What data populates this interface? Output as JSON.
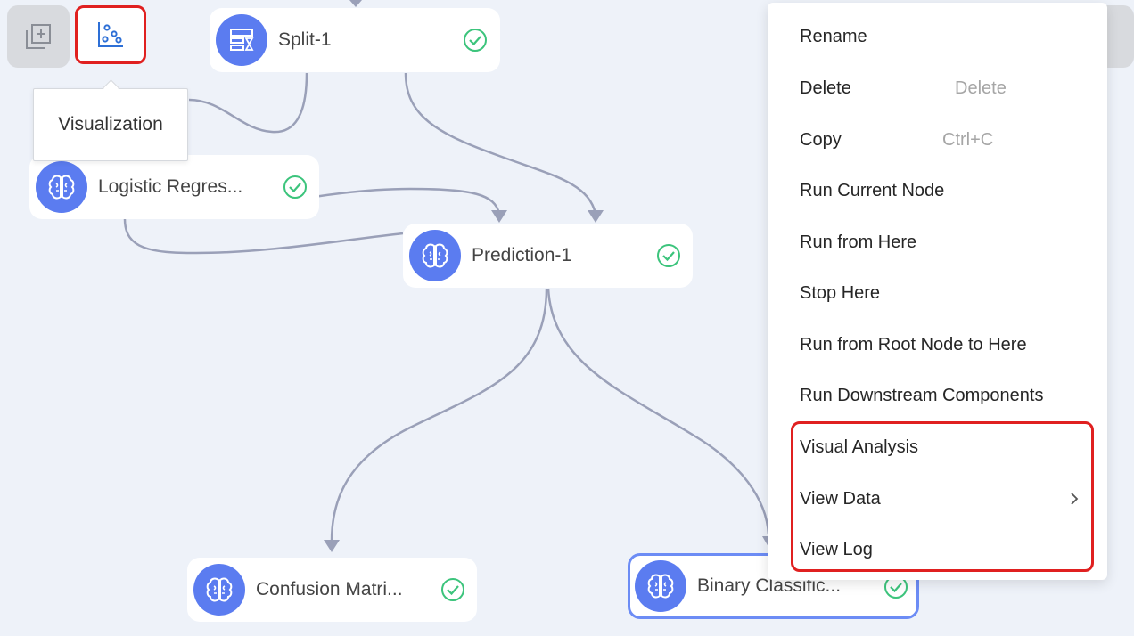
{
  "toolbar": {
    "add_icon": "add-frame-icon",
    "viz_icon": "scatter-chart-icon",
    "tooltip": "Visualization"
  },
  "nodes": {
    "split": {
      "label": "Split-1",
      "icon": "split-table-icon",
      "status": "success"
    },
    "logistic": {
      "label": "Logistic Regres...",
      "icon": "brain-icon",
      "status": "success"
    },
    "prediction": {
      "label": "Prediction-1",
      "icon": "brain-icon",
      "status": "success"
    },
    "confusion": {
      "label": "Confusion Matri...",
      "icon": "brain-icon",
      "status": "success"
    },
    "binary": {
      "label": "Binary Classific...",
      "icon": "brain-icon",
      "status": "success"
    }
  },
  "context_menu": {
    "items": [
      {
        "label": "Rename",
        "shortcut": ""
      },
      {
        "label": "Delete",
        "shortcut": "Delete"
      },
      {
        "label": "Copy",
        "shortcut": "Ctrl+C"
      },
      {
        "label": "Run Current Node",
        "shortcut": ""
      },
      {
        "label": "Run from Here",
        "shortcut": ""
      },
      {
        "label": "Stop Here",
        "shortcut": ""
      },
      {
        "label": "Run from Root Node to Here",
        "shortcut": ""
      },
      {
        "label": "Run Downstream Components",
        "shortcut": ""
      },
      {
        "label": "Visual Analysis",
        "shortcut": ""
      },
      {
        "label": "View Data",
        "shortcut": "",
        "submenu": true
      },
      {
        "label": "View Log",
        "shortcut": ""
      }
    ]
  },
  "colors": {
    "accent": "#5b7cf0",
    "success": "#3cc47c",
    "highlight": "#e02020",
    "edge": "#9aa0b8",
    "canvas": "#eef2f9"
  }
}
